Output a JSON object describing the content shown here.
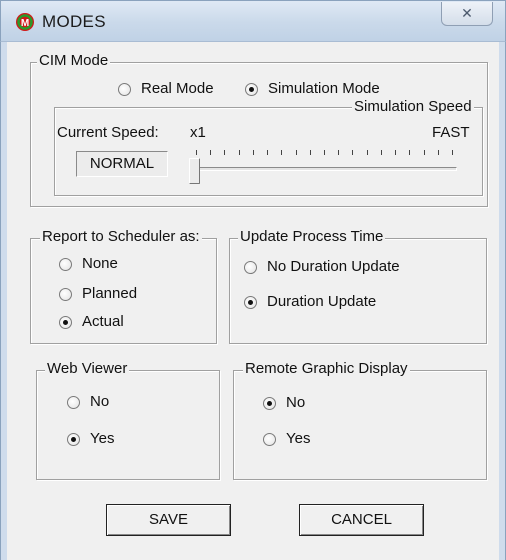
{
  "window": {
    "title": "MODES",
    "close_glyph": "✕"
  },
  "cim_mode": {
    "legend": "CIM Mode",
    "options": [
      {
        "label": "Real Mode",
        "selected": false
      },
      {
        "label": "Simulation Mode",
        "selected": true
      }
    ],
    "simulation_speed": {
      "legend": "Simulation Speed",
      "current_speed_label": "Current Speed:",
      "current_speed_value": "NORMAL",
      "min_label": "x1",
      "max_label": "FAST",
      "slider_position": 0
    }
  },
  "report_to_scheduler": {
    "legend": "Report to Scheduler as:",
    "options": [
      {
        "label": "None",
        "selected": false
      },
      {
        "label": "Planned",
        "selected": false
      },
      {
        "label": "Actual",
        "selected": true
      }
    ]
  },
  "update_process_time": {
    "legend": "Update Process Time",
    "options": [
      {
        "label": "No Duration Update",
        "selected": false
      },
      {
        "label": "Duration Update",
        "selected": true
      }
    ]
  },
  "web_viewer": {
    "legend": "Web Viewer",
    "options": [
      {
        "label": "No",
        "selected": false
      },
      {
        "label": "Yes",
        "selected": true
      }
    ]
  },
  "remote_graphic_display": {
    "legend": "Remote Graphic Display",
    "options": [
      {
        "label": "No",
        "selected": true
      },
      {
        "label": "Yes",
        "selected": false
      }
    ]
  },
  "buttons": {
    "save": "SAVE",
    "cancel": "CANCEL"
  },
  "icons": {
    "app": "cim-logo-icon",
    "close": "close-icon"
  },
  "colors": {
    "logo_red": "#d01818",
    "logo_green": "#2a9a2a"
  }
}
